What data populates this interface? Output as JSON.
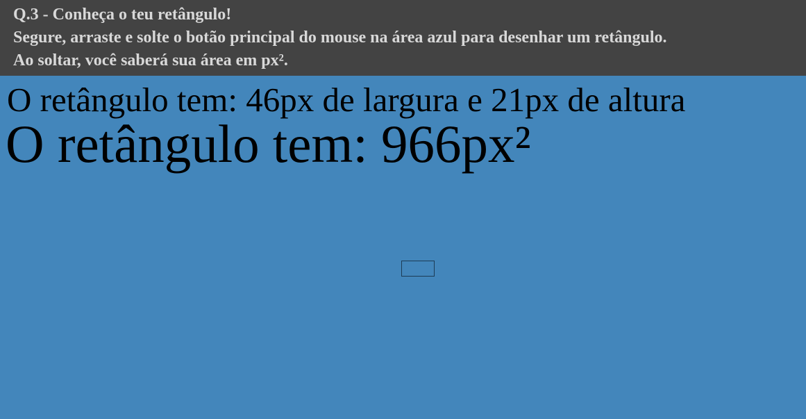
{
  "header": {
    "title": "Q.3 - Conheça o teu retângulo!",
    "line1": "Segure, arraste e solte o botão principal do mouse na área azul para desenhar um retângulo.",
    "line2": "Ao soltar, você saberá sua área em px²."
  },
  "canvas": {
    "dims_text": "O retângulo tem: 46px de largura e 21px de altura",
    "area_text": "O retângulo tem: 966px²",
    "background_color": "#4386bb"
  }
}
